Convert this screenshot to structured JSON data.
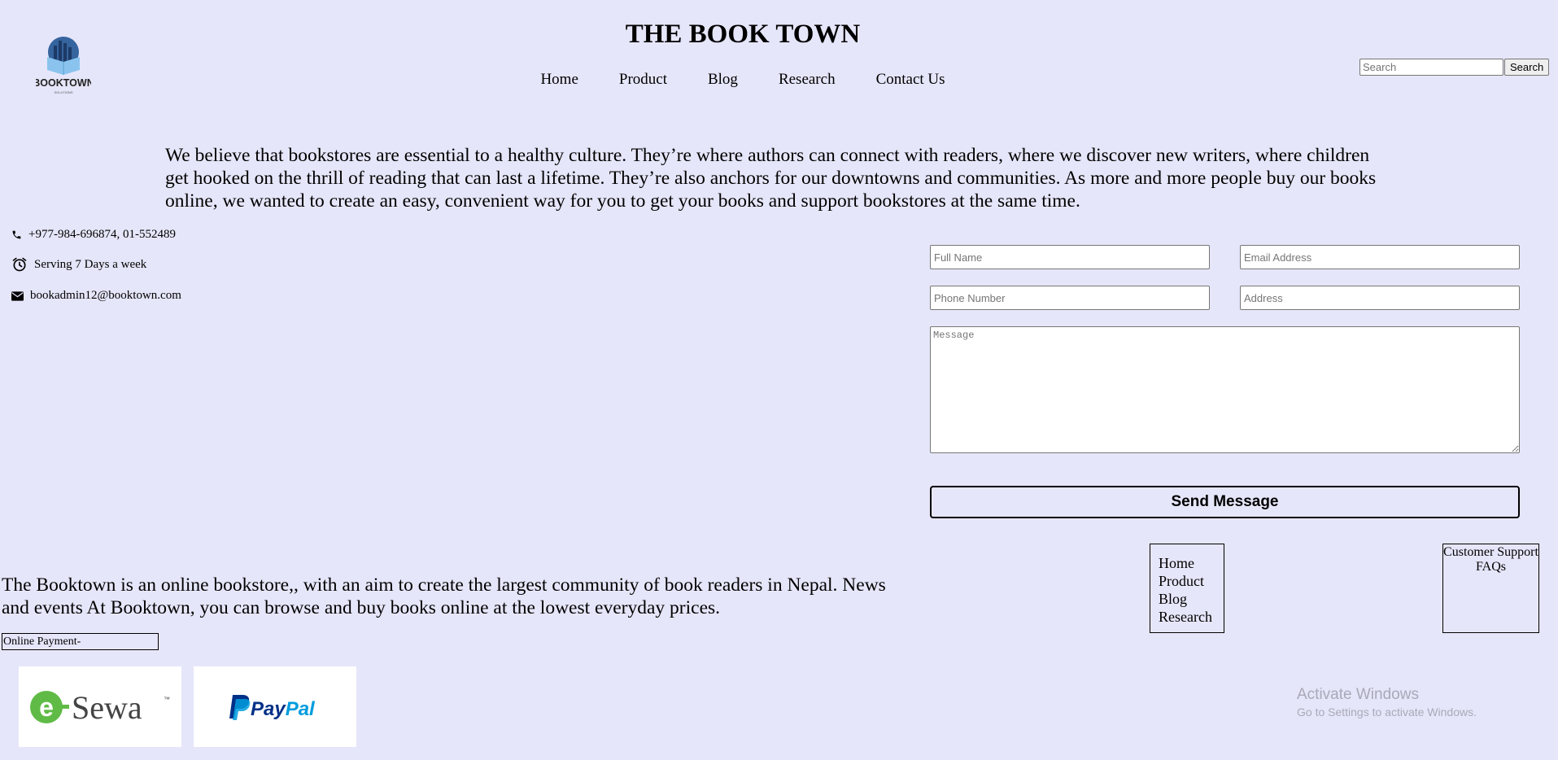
{
  "header": {
    "logo_text": "BOOKTOWN",
    "logo_tagline": "SOLUTIONS",
    "title": "THE BOOK TOWN",
    "nav": [
      "Home",
      "Product",
      "Blog",
      "Research",
      "Contact Us"
    ],
    "search_placeholder": "Search",
    "search_button": "Search"
  },
  "intro": "We believe that bookstores are essential to a healthy culture. They’re where authors can connect with readers, where we discover new writers, where children get hooked on the thrill of reading that can last a lifetime. They’re also anchors for our downtowns and communities. As more and more people buy our books online, we wanted to create an easy, convenient way for you to get your books and support bookstores at the same time.",
  "contact": {
    "phone": "+977-984-696874, 01-552489",
    "hours": "Serving 7 Days a week",
    "email": "bookadmin12@booktown.com"
  },
  "form": {
    "full_name_placeholder": "Full Name",
    "email_placeholder": "Email Address",
    "phone_placeholder": "Phone Number",
    "address_placeholder": "Address",
    "message_placeholder": "Message",
    "send_label": "Send Message"
  },
  "footer": {
    "about": "The Booktown is an online bookstore,, with an aim to create the largest community of book readers in Nepal. News and events At Booktown, you can browse and buy books online at the lowest everyday prices.",
    "payment_label": "Online Payment-",
    "payment_logos": [
      "e-Sewa",
      "PayPal"
    ],
    "links": [
      "Home",
      "Product",
      "Blog",
      "Research"
    ],
    "support": [
      "Customer Support",
      "FAQs"
    ]
  },
  "watermark": {
    "line1": "Activate Windows",
    "line2": "Go to Settings to activate Windows."
  },
  "colors": {
    "background": "#e6e6fa",
    "esewa_green": "#60bb46",
    "paypal_dark": "#003087",
    "paypal_light": "#009cde"
  }
}
